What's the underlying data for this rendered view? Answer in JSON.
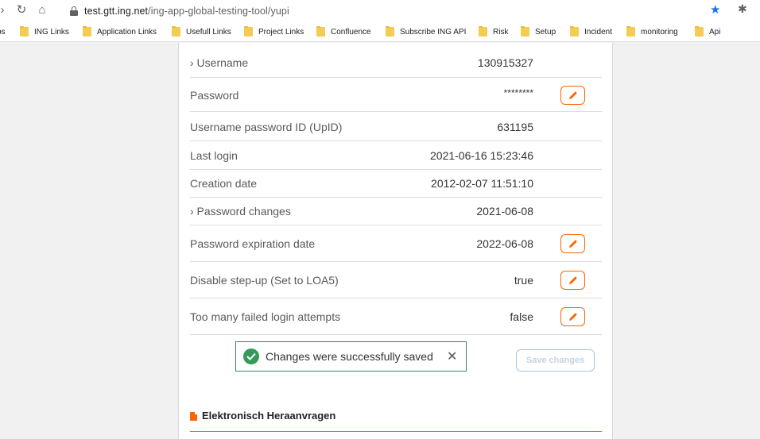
{
  "browser": {
    "url_host": "test.gtt.ing.net",
    "url_path": "/ing-app-global-testing-tool/yupi",
    "bookmarks": [
      "ps",
      "ING Links",
      "Application Links",
      "Usefull Links",
      "Project Links",
      "Confluence",
      "Subscribe ING API",
      "Risk",
      "Setup",
      "Incident",
      "monitoring",
      "Api"
    ]
  },
  "details": {
    "rows": [
      {
        "label": "› Username",
        "value": "130915327"
      },
      {
        "label": "Password",
        "value": "********"
      },
      {
        "label": "Username password ID (UpID)",
        "value": "631195"
      },
      {
        "label": "Last login",
        "value": "2021-06-16 15:23:46"
      },
      {
        "label": "Creation date",
        "value": "2012-02-07 11:51:10"
      },
      {
        "label": "› Password changes",
        "value": "2021-06-08"
      },
      {
        "label": "Password expiration date",
        "value": "2022-06-08"
      },
      {
        "label": "Disable step-up (Set to LOA5)",
        "value": "true"
      },
      {
        "label": "Too many failed login attempts",
        "value": "false"
      }
    ]
  },
  "toast": {
    "message": "Changes were successfully saved",
    "close": "✕"
  },
  "save_button": "Save changes",
  "section": {
    "title": "Elektronisch Heraanvragen"
  },
  "colors": {
    "accent": "#ff6200",
    "success": "#349a58",
    "link_blue": "#1a73e8"
  }
}
